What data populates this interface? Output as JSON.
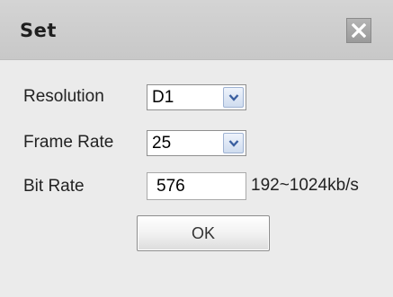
{
  "dialog": {
    "title": "Set",
    "close_icon": "close-icon"
  },
  "fields": {
    "resolution": {
      "label": "Resolution",
      "value": "D1"
    },
    "frame_rate": {
      "label": "Frame Rate",
      "value": "25"
    },
    "bit_rate": {
      "label": "Bit Rate",
      "value": "576",
      "range": "192~1024kb/s"
    }
  },
  "buttons": {
    "ok_label": "OK"
  },
  "colors": {
    "background": "#ebebeb",
    "title_bar": "#cccccc",
    "close_button": "#a8a8a8",
    "select_arrow": "#cfdcef",
    "arrow_glyph": "#3a5fa0"
  }
}
